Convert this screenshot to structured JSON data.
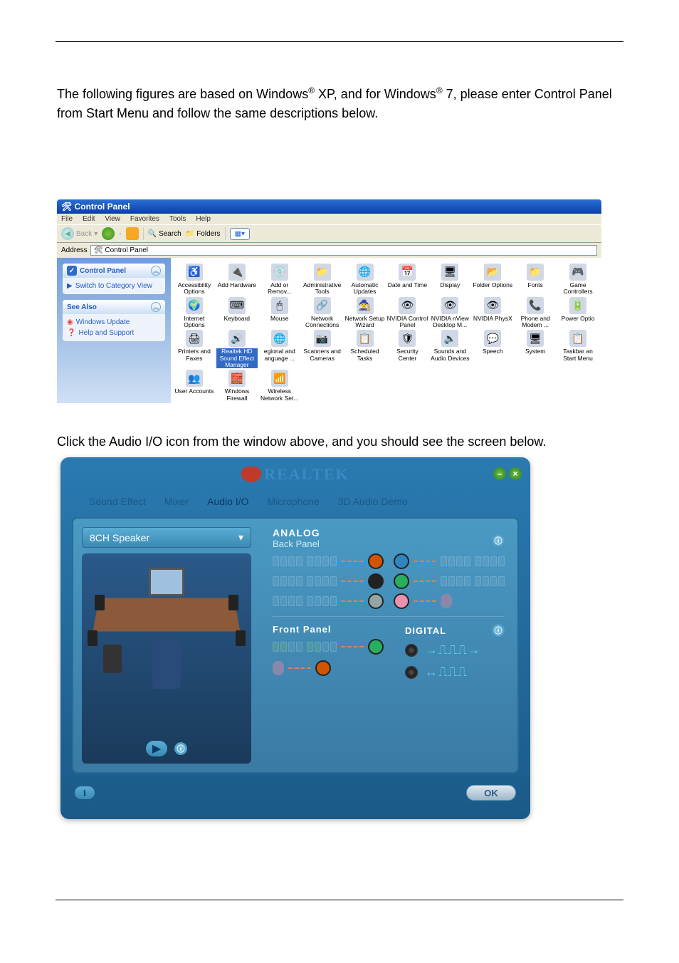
{
  "instruction_1a": "The following figures are based on Windows",
  "instruction_1b": " XP, and for Windows",
  "instruction_1c": " 7, please enter Control Panel from Start Menu and follow the same descriptions below.",
  "instruction_2": "Click the Audio I/O icon from the window above, and you should see the screen below.",
  "control_panel": {
    "title": "Control Panel",
    "menu": [
      "File",
      "Edit",
      "View",
      "Favorites",
      "Tools",
      "Help"
    ],
    "back": "Back",
    "search": "Search",
    "folders": "Folders",
    "address_label": "Address",
    "address_value": "Control Panel",
    "side_cp_title": "Control Panel",
    "switch_view": "Switch to Category View",
    "see_also": "See Also",
    "windows_update": "Windows Update",
    "help_support": "Help and Support",
    "items": [
      {
        "label": "Accessibility Options",
        "glyph": "♿"
      },
      {
        "label": "Add Hardware",
        "glyph": "🔌"
      },
      {
        "label": "Add or Remov...",
        "glyph": "💿"
      },
      {
        "label": "Administrative Tools",
        "glyph": "📁"
      },
      {
        "label": "Automatic Updates",
        "glyph": "🌐"
      },
      {
        "label": "Date and Time",
        "glyph": "📅"
      },
      {
        "label": "Display",
        "glyph": "🖥"
      },
      {
        "label": "Folder Options",
        "glyph": "📂"
      },
      {
        "label": "Fonts",
        "glyph": "📁"
      },
      {
        "label": "Game Controllers",
        "glyph": "🎮"
      },
      {
        "label": "Internet Options",
        "glyph": "🌍"
      },
      {
        "label": "Keyboard",
        "glyph": "⌨"
      },
      {
        "label": "Mouse",
        "glyph": "🖱"
      },
      {
        "label": "Network Connections",
        "glyph": "🔗"
      },
      {
        "label": "Network Setup Wizard",
        "glyph": "🧙"
      },
      {
        "label": "NVIDIA Control Panel",
        "glyph": "👁"
      },
      {
        "label": "NVIDIA nView Desktop M...",
        "glyph": "👁"
      },
      {
        "label": "NVIDIA PhysX",
        "glyph": "👁"
      },
      {
        "label": "Phone and Modem ...",
        "glyph": "📞"
      },
      {
        "label": "Power Optio",
        "glyph": "🔋"
      },
      {
        "label": "Printers and Faxes",
        "glyph": "🖨"
      },
      {
        "label": "Realtek HD Sound Effect Manager",
        "glyph": "🔊",
        "hl": true
      },
      {
        "label": "egional and anguage ...",
        "glyph": "🌐"
      },
      {
        "label": "Scanners and Cameras",
        "glyph": "📷"
      },
      {
        "label": "Scheduled Tasks",
        "glyph": "📋"
      },
      {
        "label": "Security Center",
        "glyph": "🛡"
      },
      {
        "label": "Sounds and Audio Devices",
        "glyph": "🔈"
      },
      {
        "label": "Speech",
        "glyph": "💬"
      },
      {
        "label": "System",
        "glyph": "🖥"
      },
      {
        "label": "Taskbar an Start Menu",
        "glyph": "📋"
      },
      {
        "label": "User Accounts",
        "glyph": "👥"
      },
      {
        "label": "Windows Firewall",
        "glyph": "🧱"
      },
      {
        "label": "Wireless Network Set...",
        "glyph": "📶"
      }
    ]
  },
  "realtek": {
    "logo": "REALTEK",
    "tabs": [
      "Sound Effect",
      "Mixer",
      "Audio I/O",
      "Microphone",
      "3D Audio Demo"
    ],
    "active_tab": 2,
    "speaker_mode": "8CH Speaker",
    "analog_title": "ANALOG",
    "back_panel": "Back Panel",
    "front_panel": "Front Panel",
    "digital_title": "DIGITAL",
    "ok": "OK",
    "back_jacks": [
      {
        "color": "#d35400",
        "side": "L"
      },
      {
        "color": "#2e86c1",
        "side": "R"
      },
      {
        "color": "#222",
        "side": "L"
      },
      {
        "color": "#27ae60",
        "side": "R"
      },
      {
        "color": "#95a5a6",
        "side": "L"
      },
      {
        "color": "#e991b0",
        "side": "R",
        "mic": true
      }
    ],
    "front_jacks": [
      {
        "color": "#27ae60"
      },
      {
        "color": "#d35400",
        "mic": true
      }
    ]
  }
}
